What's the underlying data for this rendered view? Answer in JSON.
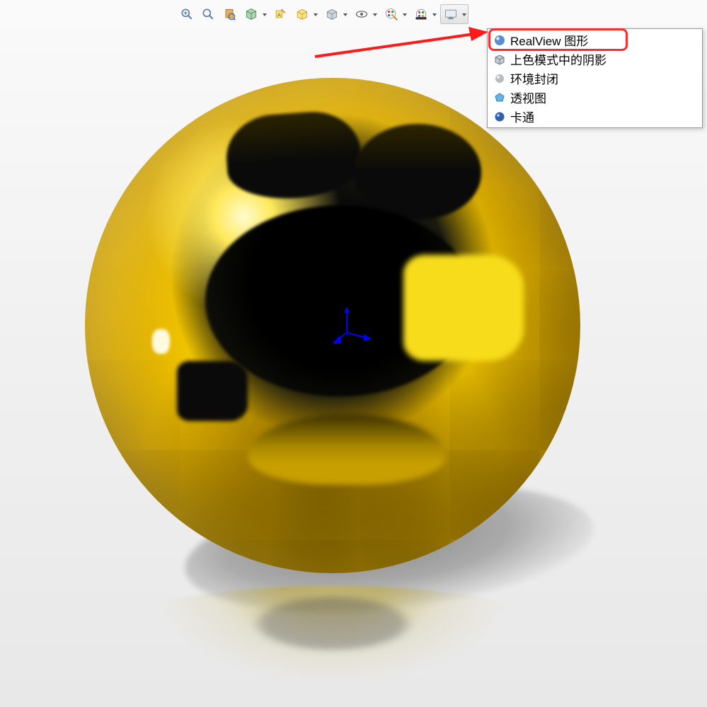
{
  "toolbar": {
    "buttons": [
      {
        "name": "zoom-to-fit-icon"
      },
      {
        "name": "zoom-area-icon"
      },
      {
        "name": "previous-view-icon"
      },
      {
        "name": "section-view-icon",
        "dropdown": true
      },
      {
        "name": "dynamic-annotation-icon"
      },
      {
        "name": "view-orientation-icon",
        "dropdown": true
      },
      {
        "name": "display-style-icon",
        "dropdown": true
      },
      {
        "name": "hide-show-icon",
        "dropdown": true
      },
      {
        "name": "edit-appearance-icon",
        "dropdown": true
      },
      {
        "name": "apply-scene-icon",
        "dropdown": true
      },
      {
        "name": "view-settings-icon",
        "dropdown": true,
        "active": true
      }
    ]
  },
  "menu": {
    "items": [
      {
        "icon": "realview-sphere-icon",
        "label": "RealView 图形"
      },
      {
        "icon": "shaded-cube-icon",
        "label": "上色模式中的阴影"
      },
      {
        "icon": "ambient-occlusion-icon",
        "label": "环境封闭"
      },
      {
        "icon": "perspective-icon",
        "label": "透视图"
      },
      {
        "icon": "cartoon-icon",
        "label": "卡通"
      }
    ]
  }
}
